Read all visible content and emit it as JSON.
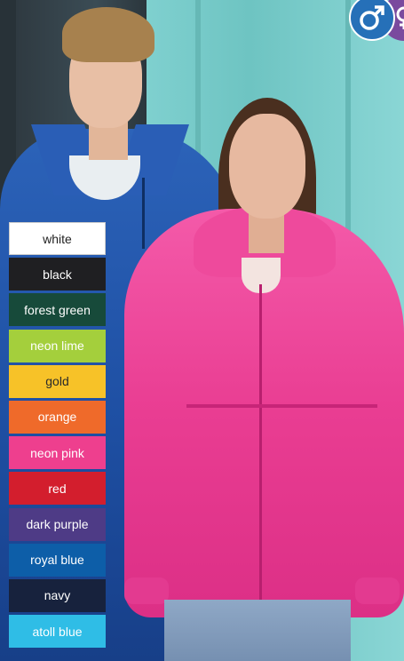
{
  "swatches": [
    {
      "label": "white",
      "bg": "#ffffff",
      "fg": "#222222",
      "border": "#cccccc"
    },
    {
      "label": "black",
      "bg": "#1f1f22",
      "fg": "#ffffff"
    },
    {
      "label": "forest green",
      "bg": "#174a3a",
      "fg": "#ffffff"
    },
    {
      "label": "neon lime",
      "bg": "#a4cf3c",
      "fg": "#ffffff"
    },
    {
      "label": "gold",
      "bg": "#f7c228",
      "fg": "#2a2a2a"
    },
    {
      "label": "orange",
      "bg": "#ef6a2a",
      "fg": "#ffffff"
    },
    {
      "label": "neon pink",
      "bg": "#ee3f8e",
      "fg": "#ffffff"
    },
    {
      "label": "red",
      "bg": "#d31e2d",
      "fg": "#ffffff"
    },
    {
      "label": "dark purple",
      "bg": "#4e3b86",
      "fg": "#ffffff"
    },
    {
      "label": "royal blue",
      "bg": "#0d5ea8",
      "fg": "#ffffff"
    },
    {
      "label": "navy",
      "bg": "#17223d",
      "fg": "#ffffff"
    },
    {
      "label": "atoll blue",
      "bg": "#2fbde6",
      "fg": "#ffffff"
    }
  ],
  "badges": {
    "male_icon": "male-symbol-icon",
    "female_icon": "female-symbol-icon",
    "male_color": "#2670b8",
    "female_color": "#7a4a9e"
  }
}
